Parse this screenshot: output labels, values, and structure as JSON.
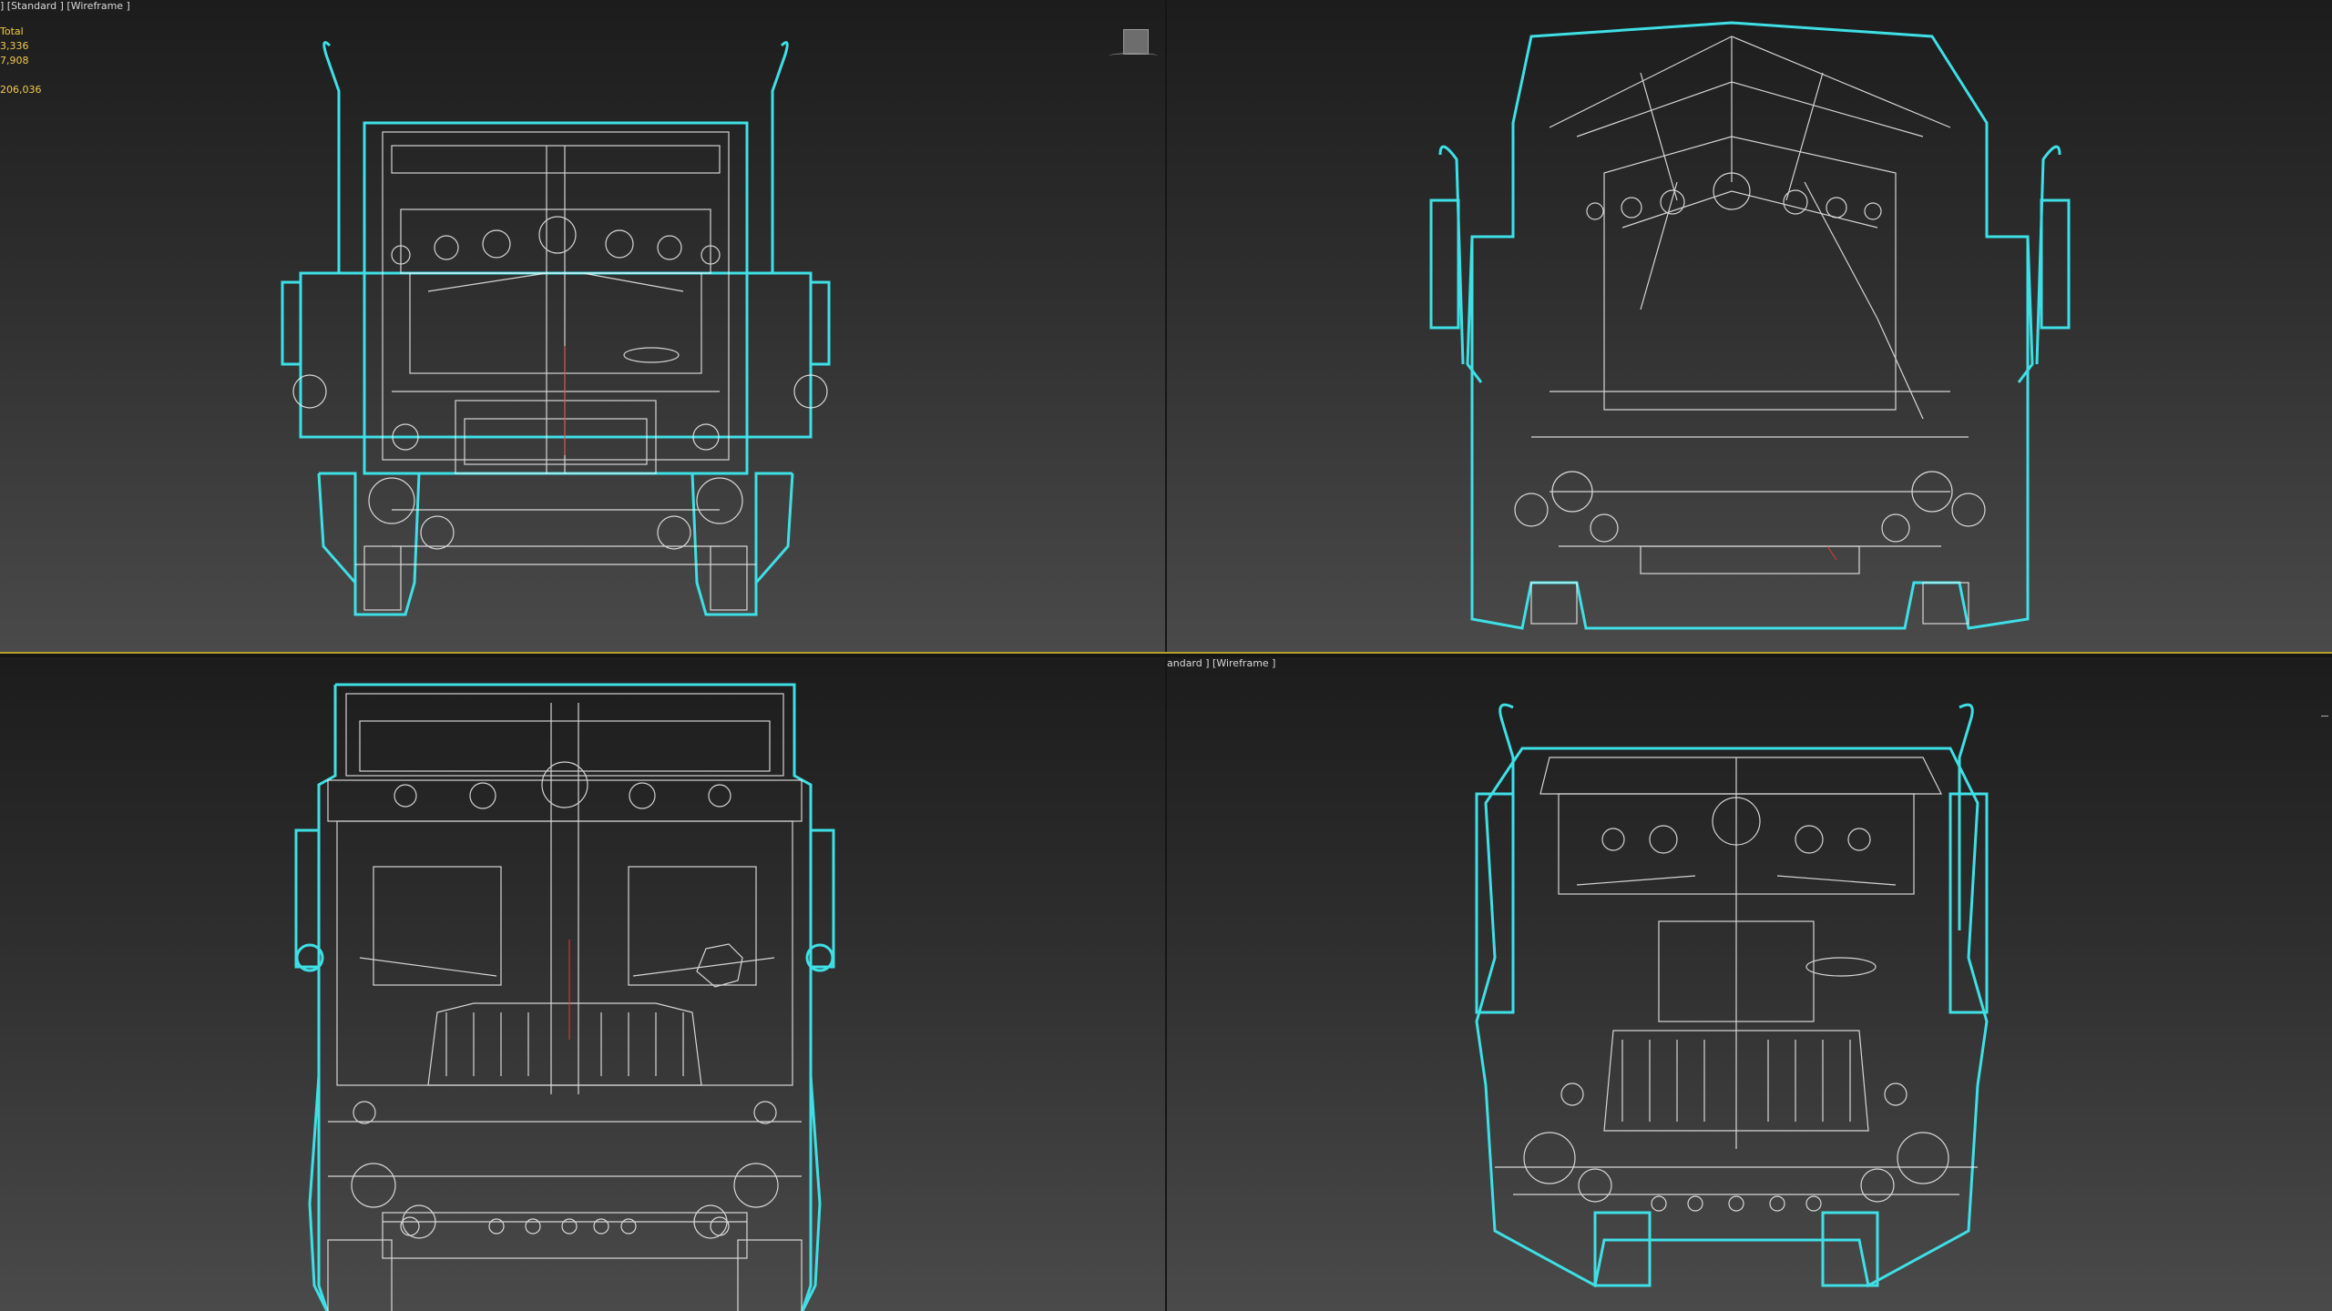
{
  "viewports": {
    "top_left": {
      "label": "] [Standard ] [Wireframe ]",
      "stats": {
        "header": "Total",
        "line1": "3,336",
        "line2": "7,908",
        "line3": "206,036"
      }
    },
    "top_right": {
      "label": ""
    },
    "bottom_left": {
      "label": ""
    },
    "bottom_right": {
      "label": "andard ] [Wireframe ]"
    }
  },
  "colors": {
    "wire_outline": "#3ee0e6",
    "wire_inner": "#f2f2f2",
    "stats_text": "#f2c94c",
    "active_border": "#b5a02a",
    "pivot_mark": "#e03a3a"
  },
  "icons": {
    "viewcube": "viewcube-icon"
  }
}
